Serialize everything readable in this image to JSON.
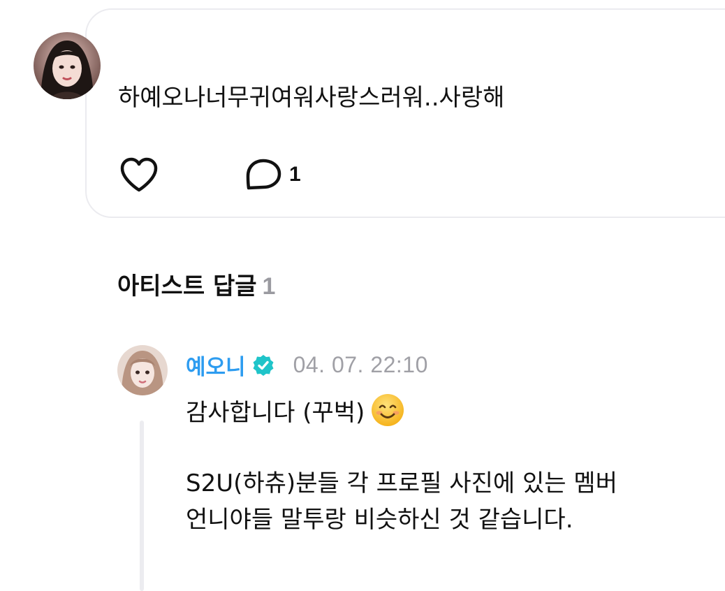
{
  "comment": {
    "avatar_icon": "fan-profile-photo",
    "text": "하예오나너무귀여워사랑스러워..사랑해",
    "like_icon": "heart-outline-icon",
    "reply_icon": "speech-bubble-icon",
    "reply_count": "1"
  },
  "artist_replies": {
    "title": "아티스트 답글",
    "count": "1"
  },
  "reply": {
    "avatar_icon": "artist-profile-photo",
    "author": "예오니",
    "verified_icon": "verified-badge-icon",
    "timestamp": "04. 07. 22:10",
    "line1": "감사합니다 (꾸벅)",
    "emoji_icon": "smiling-face-emoji",
    "line2": "S2U(하츄)분들 각 프로필 사진에 있는 멤버",
    "line3": "언니야들 말투랑 비슷하신 것 같습니다."
  },
  "colors": {
    "accent": "#2d9cf0",
    "muted": "#a0a0a6",
    "border": "#ebebef",
    "verified": "#1fc4c9"
  }
}
